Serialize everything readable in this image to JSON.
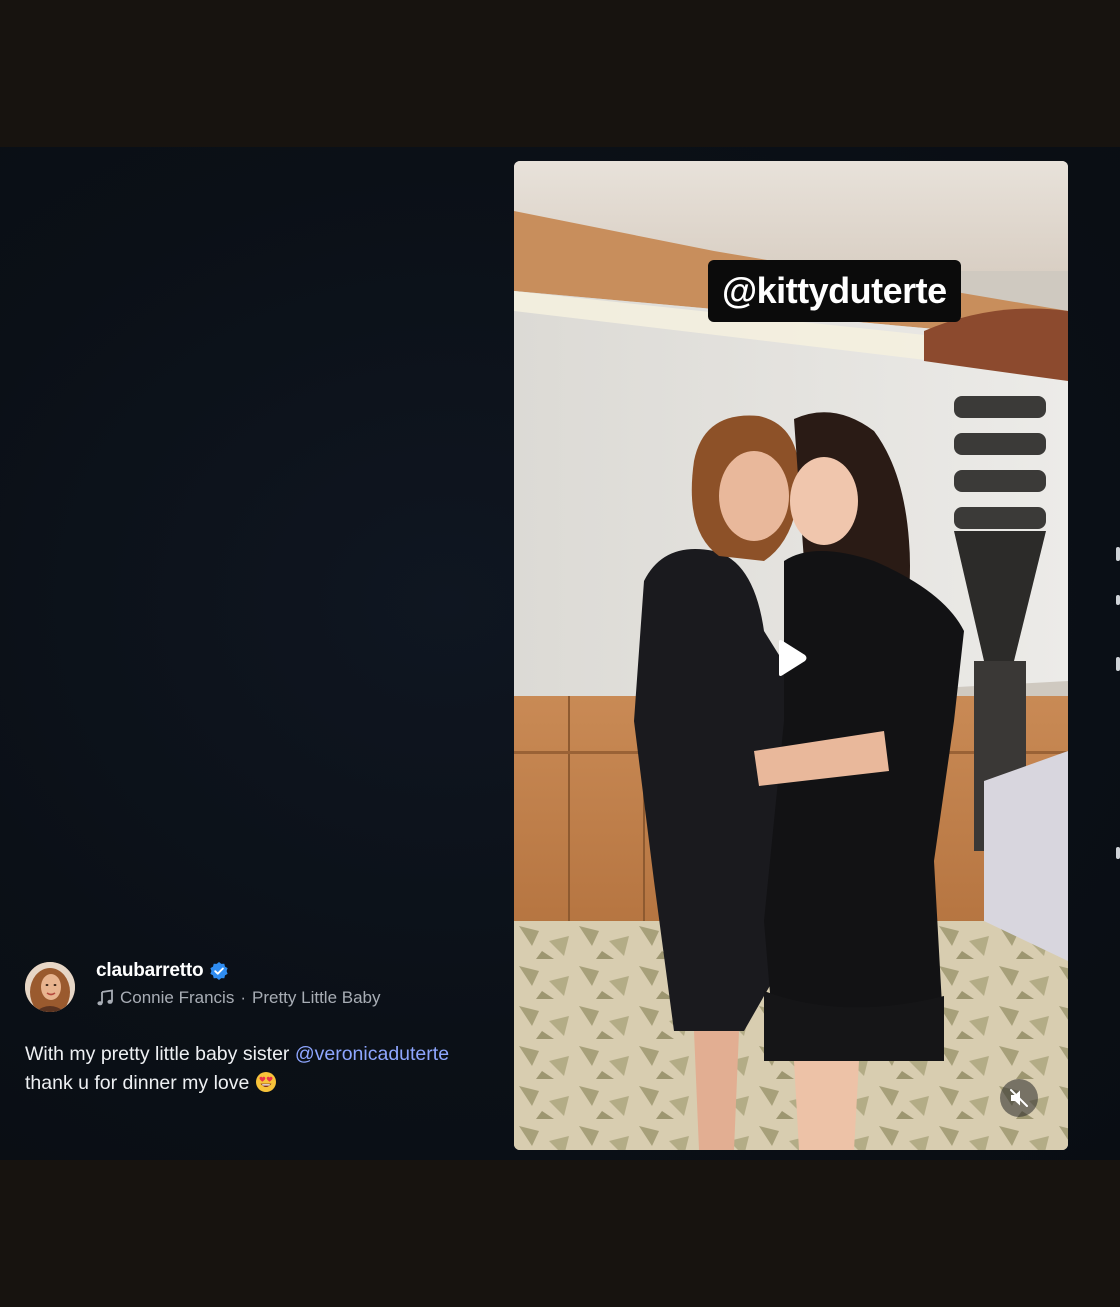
{
  "post": {
    "username": "claubarretto",
    "verified": true,
    "music": {
      "artist": "Connie Francis",
      "separator": "·",
      "track": "Pretty Little Baby"
    },
    "caption": {
      "text_before": "With my pretty little baby sister ",
      "mention": "@veronicaduterte",
      "text_after": " thank u for dinner my love",
      "emoji": "smiling-face-with-heart-eyes"
    }
  },
  "video": {
    "tag_sticker": "@kittyduterte",
    "play_icon": "play-icon",
    "mute_icon": "muted-speaker-icon"
  },
  "colors": {
    "background": "#17130f",
    "viewer": "#0b1017",
    "mention": "#8ea6ff",
    "verified": "#2f8cf0"
  }
}
